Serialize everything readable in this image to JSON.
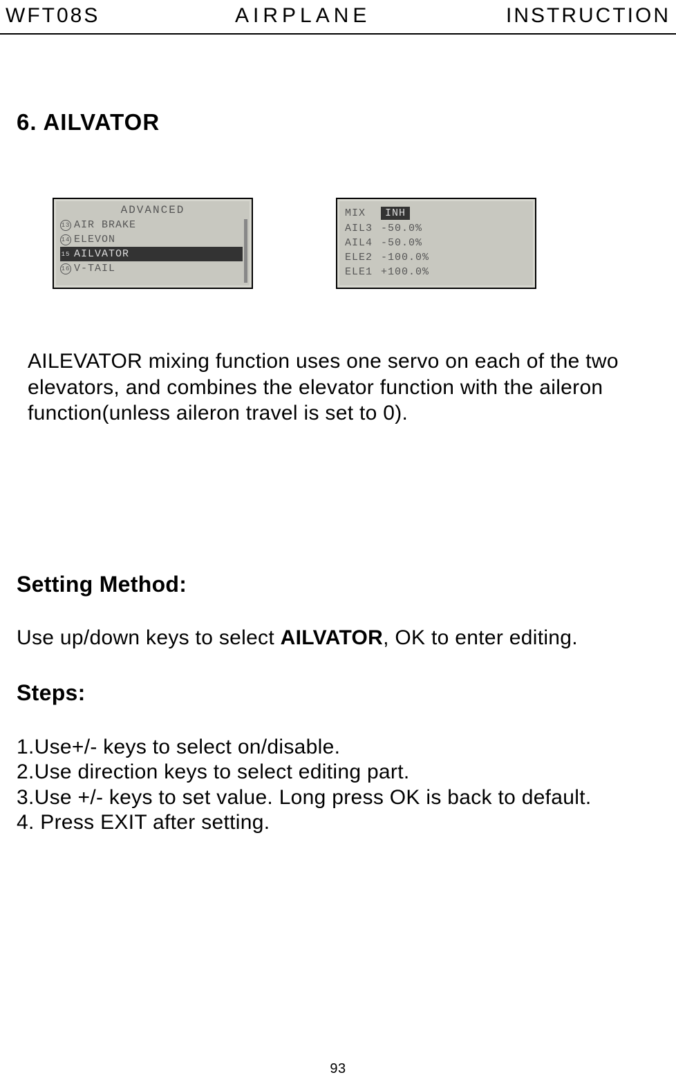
{
  "header": {
    "left": "WFT08S",
    "center": "AIRPLANE",
    "right": "INSTRUCTION"
  },
  "section_title": "6. AILVATOR",
  "lcd1": {
    "title": "ADVANCED",
    "items": [
      {
        "num": "13",
        "label": "AIR BRAKE",
        "selected": false
      },
      {
        "num": "14",
        "label": "ELEVON",
        "selected": false
      },
      {
        "num": "15",
        "label": "AILVATOR",
        "selected": true
      },
      {
        "num": "16",
        "label": "V-TAIL",
        "selected": false
      }
    ]
  },
  "lcd2": {
    "rows": [
      {
        "label": "MIX",
        "value": "INH",
        "badge": true
      },
      {
        "label": "AIL3",
        "value": "-50.0%",
        "badge": false
      },
      {
        "label": "AIL4",
        "value": "-50.0%",
        "badge": false
      },
      {
        "label": "ELE2",
        "value": "-100.0%",
        "badge": false
      },
      {
        "label": "ELE1",
        "value": "+100.0%",
        "badge": false
      }
    ]
  },
  "description": "AILEVATOR mixing function uses one servo on each of the two elevators, and combines the elevator function with the aileron function(unless aileron travel is set to 0).",
  "setting_heading": "Setting Method:",
  "setting_line_pre": "Use up/down keys to select ",
  "setting_line_bold": "AILVATOR",
  "setting_line_post": ", OK to enter editing.",
  "steps_heading": "Steps:",
  "steps": [
    "1.Use+/- keys  to select on/disable.",
    "2.Use direction keys to select editing part.",
    "3.Use +/- keys to set value. Long press OK is back to default.",
    "4. Press EXIT after setting."
  ],
  "page_number": "93"
}
